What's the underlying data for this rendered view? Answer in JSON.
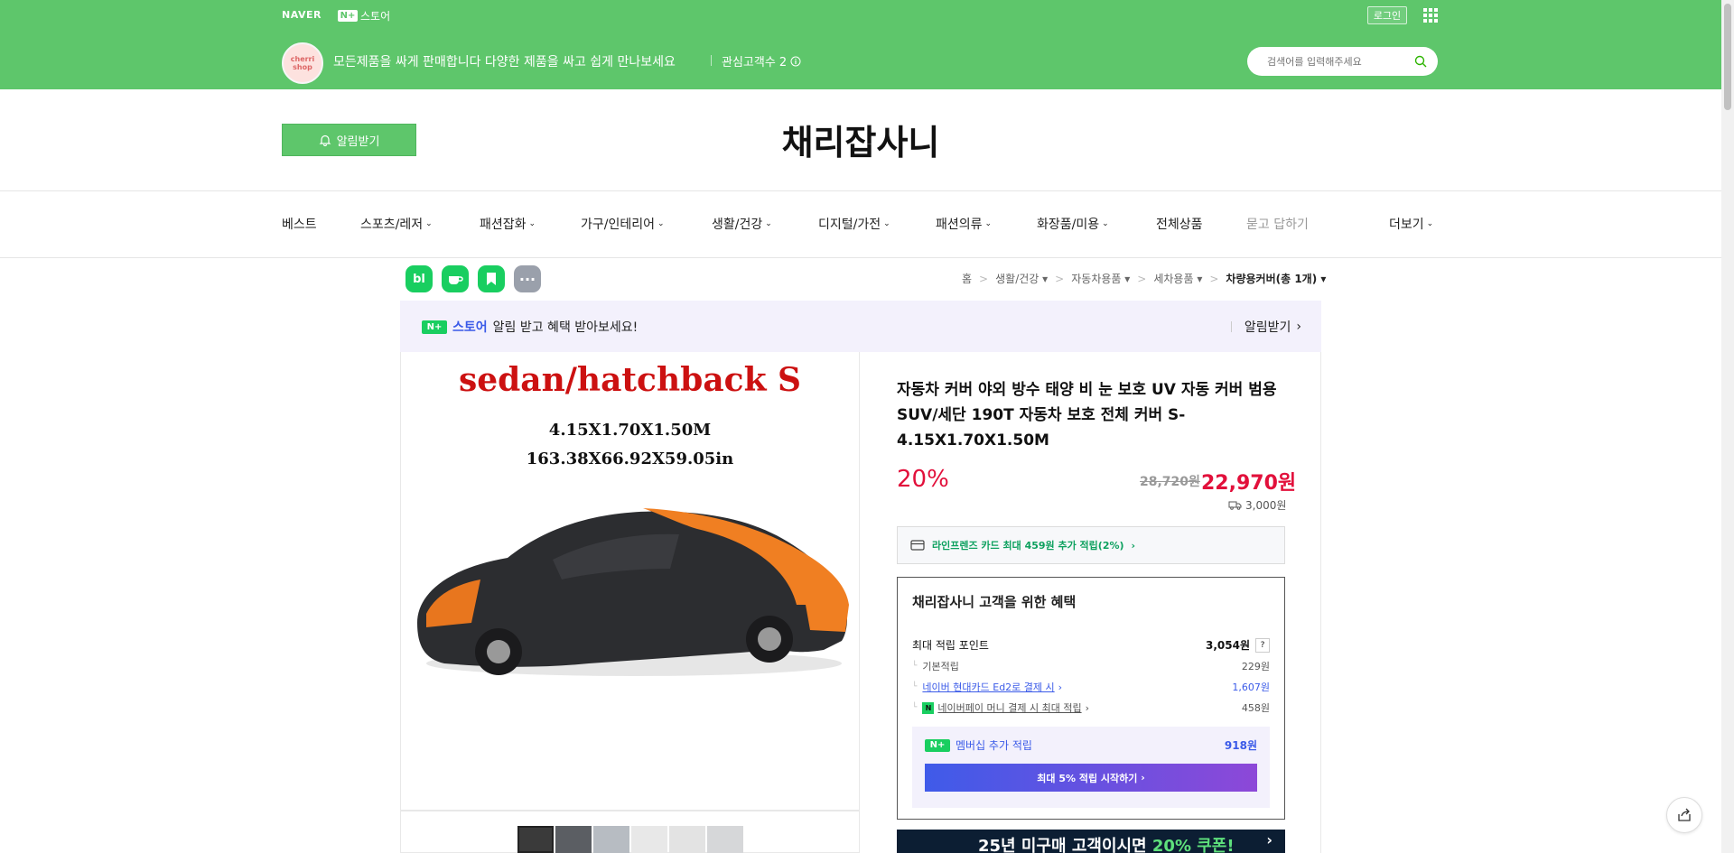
{
  "topbar": {
    "naver_logo": "NAVER",
    "nplus_badge": "N+",
    "nplus_store": "스토어",
    "login": "로그인"
  },
  "store": {
    "avatar_text": "cherri shop",
    "description": "모든제품을 싸게 판매합니다 다양한 제품을 싸고 쉽게 만나보세요",
    "fans": "관심고객수 2",
    "search_placeholder": "검색어를 입력해주세요",
    "alarm_button": "알림받기",
    "name": "채리잡사니"
  },
  "nav": [
    {
      "label": "베스트"
    },
    {
      "label": "스포츠/레저"
    },
    {
      "label": "패션잡화"
    },
    {
      "label": "가구/인테리어"
    },
    {
      "label": "생활/건강"
    },
    {
      "label": "디지털/가전"
    },
    {
      "label": "패션의류"
    },
    {
      "label": "화장품/미용"
    },
    {
      "label": "전체상품"
    },
    {
      "label": "묻고 답하기"
    },
    {
      "label": "더보기"
    }
  ],
  "breadcrumb": [
    "홈",
    "생활/건강",
    "자동차용품",
    "세차용품",
    "차량용커버(총 1개)"
  ],
  "banner": {
    "nplus": "N+",
    "store": "스토어",
    "text": "알림 받고 혜택 받아보세요!",
    "action": "알림받기"
  },
  "product_image": {
    "title": "sedan/hatchback S",
    "size_m": "4.15X1.70X1.50M",
    "size_in": "163.38X66.92X59.05in"
  },
  "product": {
    "title": "자동차 커버 야외 방수 태양 비 눈 보호 UV 자동 커버 범용 SUV/세단 190T 자동차 보호 전체 커버 S-4.15X1.70X1.50M",
    "discount": "20%",
    "original_price": "28,720원",
    "price": "22,970원",
    "shipping": "3,000원",
    "card_benefit": "라인프렌즈 카드 최대 459원 추가 적립(2%)"
  },
  "benefit": {
    "title": "채리잡사니 고객을 위한 혜택",
    "max_points_label": "최대 적립 포인트",
    "max_points_value": "3,054원",
    "help": "?",
    "basic_label": "기본적립",
    "basic_value": "229원",
    "card_label": "네이버 현대카드 Ed2로 결제 시",
    "card_value": "1,607원",
    "pay_label": "네이버페이 머니 결제 시 최대 적립",
    "pay_value": "458원",
    "member_label": "멤버십 추가 적립",
    "member_value": "918원",
    "member_button": "최대 5% 적립 시작하기"
  },
  "coupon_banner": {
    "text_pre": "25년 미구매 고객이시면 ",
    "text_hl": "20% 쿠폰!"
  },
  "colors": {
    "brand_green": "#5ec66b",
    "price_red": "#e2103b",
    "naver_blue": "#3a5ae8"
  }
}
